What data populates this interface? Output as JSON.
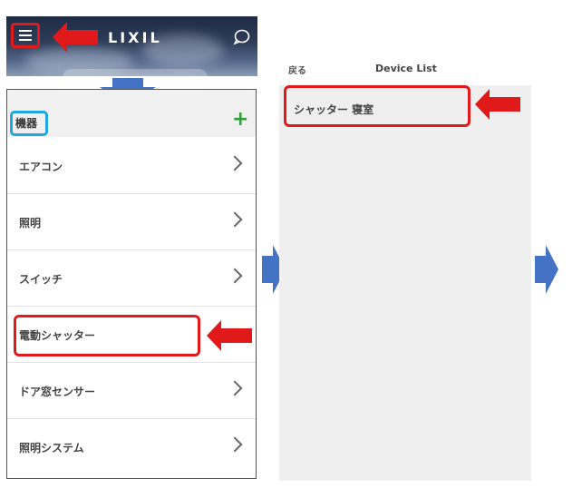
{
  "header": {
    "logo": "LIXIL"
  },
  "list_panel": {
    "section_label": "機器",
    "add_symbol": "+",
    "items": [
      {
        "label": "エアコン"
      },
      {
        "label": "照明"
      },
      {
        "label": "スイッチ"
      },
      {
        "label": "電動シャッター"
      },
      {
        "label": "ドア窓センサー"
      },
      {
        "label": "照明システム"
      }
    ]
  },
  "device_list": {
    "back_label": "戻る",
    "title": "Device List",
    "items": [
      {
        "label": "シャッター 寝室"
      }
    ]
  },
  "colors": {
    "highlight_red": "#e01a1a",
    "highlight_blue": "#1ea7e1",
    "arrow_blue": "#4472c4",
    "add_green": "#2e9e3f"
  }
}
